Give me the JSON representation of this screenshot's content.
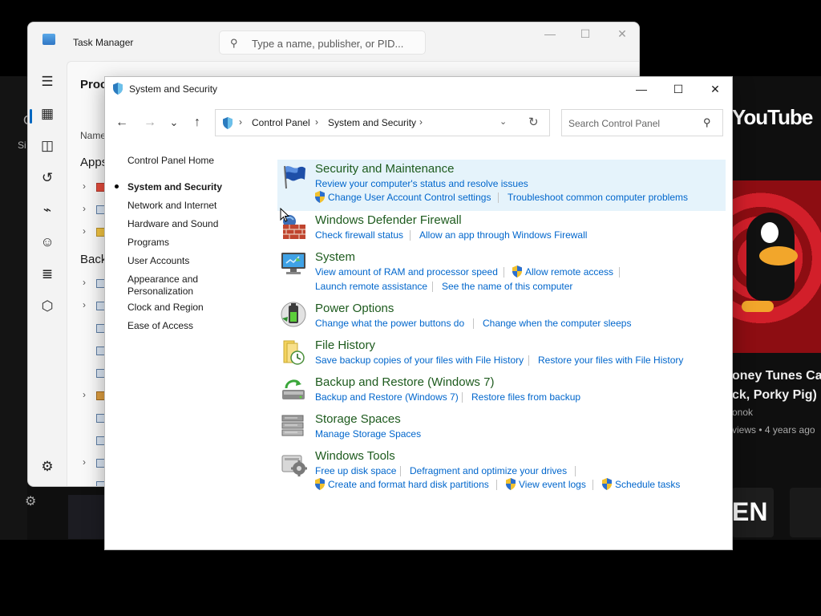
{
  "youtube": {
    "logo_text": "YouTube",
    "video_title_line1": "oney Tunes Ca",
    "video_title_line2": "ck, Porky Pig)",
    "channel": "onok",
    "meta": "views • 4 years ago",
    "tile_text": "EN",
    "side_label": "Si"
  },
  "task_manager": {
    "title": "Task Manager",
    "search_placeholder": "Type a name, publisher, or PID...",
    "heading": "Proce",
    "column_name": "Name",
    "group_apps": "Apps",
    "group_background": "Back"
  },
  "window": {
    "title": "System and Security",
    "minimize_label": "—",
    "maximize_label": "☐",
    "close_label": "✕"
  },
  "navigation": {
    "back": "←",
    "forward": "→",
    "recent": "⌄",
    "up": "↑",
    "breadcrumb": [
      "Control Panel",
      "System and Security"
    ],
    "search_placeholder": "Search Control Panel"
  },
  "left_nav": {
    "items": [
      "Control Panel Home",
      "System and Security",
      "Network and Internet",
      "Hardware and Sound",
      "Programs",
      "User Accounts",
      "Appearance and Personalization",
      "Clock and Region",
      "Ease of Access"
    ],
    "appearance_line1": "Appearance and",
    "appearance_line2": "Personalization",
    "selected": "System and Security"
  },
  "categories": [
    {
      "title": "Security and Maintenance",
      "icon": "flag-icon",
      "links": [
        "Review your computer's status and resolve issues",
        "Change User Account Control settings",
        "Troubleshoot common computer problems"
      ]
    },
    {
      "title": "Windows Defender Firewall",
      "icon": "firewall-icon",
      "links": [
        "Check firewall status",
        "Allow an app through Windows Firewall"
      ]
    },
    {
      "title": "System",
      "icon": "computer-icon",
      "links": [
        "View amount of RAM and processor speed",
        "Allow remote access",
        "Launch remote assistance",
        "See the name of this computer"
      ]
    },
    {
      "title": "Power Options",
      "icon": "battery-icon",
      "links": [
        "Change what the power buttons do",
        "Change when the computer sleeps"
      ]
    },
    {
      "title": "File History",
      "icon": "file-history-icon",
      "links": [
        "Save backup copies of your files with File History",
        "Restore your files with File History"
      ]
    },
    {
      "title": "Backup and Restore (Windows 7)",
      "icon": "backup-icon",
      "links": [
        "Backup and Restore (Windows 7)",
        "Restore files from backup"
      ]
    },
    {
      "title": "Storage Spaces",
      "icon": "storage-icon",
      "links": [
        "Manage Storage Spaces"
      ]
    },
    {
      "title": "Windows Tools",
      "icon": "tools-icon",
      "links": [
        "Free up disk space",
        "Defragment and optimize your drives",
        "Create and format hard disk partitions",
        "View event logs",
        "Schedule tasks"
      ]
    }
  ],
  "colors": {
    "category_title": "#1e5b1e",
    "link": "#0066cc",
    "selection": "#e5f3fb"
  }
}
